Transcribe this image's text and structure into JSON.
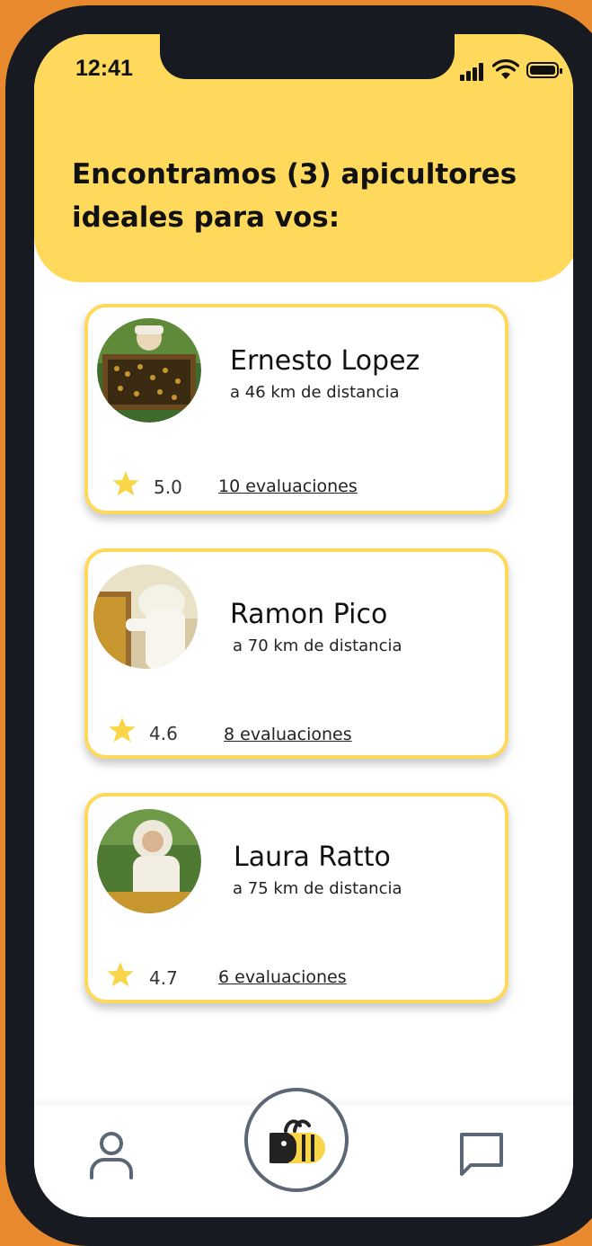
{
  "status_bar": {
    "time": "12:41"
  },
  "header": {
    "title": "Encontramos (3) apicultores ideales para vos:"
  },
  "beekeepers": [
    {
      "name": "Ernesto Lopez",
      "distance": "a 46 km de distancia",
      "rating": "5.0",
      "reviews": "10 evaluaciones"
    },
    {
      "name": "Ramon Pico",
      "distance": "a 70 km de distancia",
      "rating": "4.6",
      "reviews": "8 evaluaciones"
    },
    {
      "name": "Laura Ratto",
      "distance": "a 75 km de distancia",
      "rating": "4.7",
      "reviews": "6 evaluaciones"
    }
  ],
  "bottom_nav": {
    "items": [
      {
        "icon": "profile-icon"
      },
      {
        "icon": "bee-icon"
      },
      {
        "icon": "chat-icon"
      }
    ]
  },
  "colors": {
    "background": "#E8892E",
    "phone_frame": "#171A21",
    "header_yellow": "#FED95C",
    "star_yellow": "#F9D649",
    "nav_icon": "#5C6675"
  }
}
